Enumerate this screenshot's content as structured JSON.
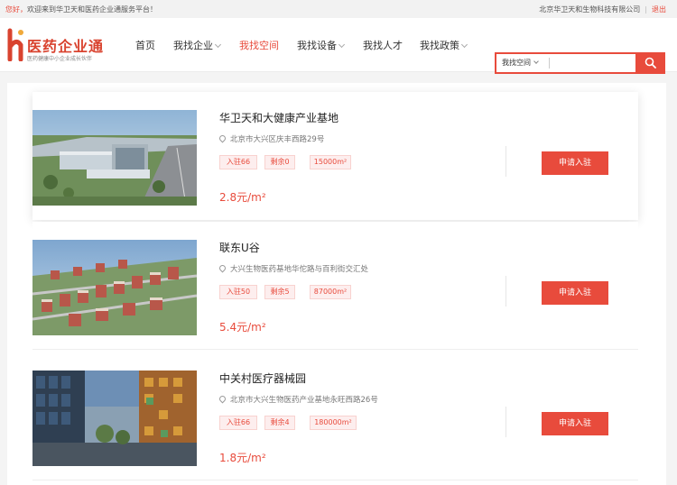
{
  "topbar": {
    "welcome_hi": "您好，",
    "welcome_rest": "欢迎来到华卫天和医药企业通服务平台！",
    "company": "北京华卫天和生物科技有限公司",
    "separator": "|",
    "logout": "退出"
  },
  "logo": {
    "name": "医药企业通",
    "slogan": "医药健康中小企业成长伙伴",
    "colors": {
      "brand": "#d9432f"
    }
  },
  "nav": {
    "items": [
      {
        "label": "首页",
        "active": false,
        "dropdown": false
      },
      {
        "label": "我找企业",
        "active": false,
        "dropdown": true
      },
      {
        "label": "我找空间",
        "active": true,
        "dropdown": false
      },
      {
        "label": "我找设备",
        "active": false,
        "dropdown": true
      },
      {
        "label": "我找人才",
        "active": false,
        "dropdown": false
      },
      {
        "label": "我找政策",
        "active": false,
        "dropdown": true
      }
    ]
  },
  "search": {
    "type_selected": "我找空间",
    "query": "",
    "button_icon": "search-icon",
    "accent": "#e84b3c"
  },
  "listings": [
    {
      "title": "华卫天和大健康产业基地",
      "address": "北京市大兴区庆丰西路29号",
      "tags": [
        "入驻66",
        "剩余0",
        "15000m²"
      ],
      "price": "2.8元/m²",
      "apply_label": "申请入驻"
    },
    {
      "title": "联东U谷",
      "address": "大兴生物医药基地华佗路与百利街交汇处",
      "tags": [
        "入驻50",
        "剩余5",
        "87000m²"
      ],
      "price": "5.4元/m²",
      "apply_label": "申请入驻"
    },
    {
      "title": "中关村医疗器械园",
      "address": "北京市大兴生物医药产业基地永旺西路26号",
      "tags": [
        "入驻66",
        "剩余4",
        "180000m²"
      ],
      "price": "1.8元/m²",
      "apply_label": "申请入驻"
    }
  ]
}
